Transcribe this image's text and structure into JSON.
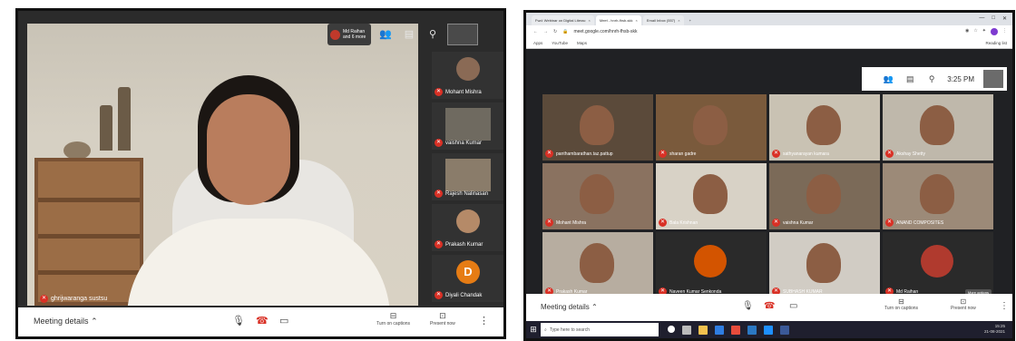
{
  "left": {
    "speaker_name": "ghrijwaranga sustsu",
    "host_chip": {
      "name": "Md Raihan",
      "sub": "and 6 more"
    },
    "participants": [
      {
        "name": "Mohant Mishra",
        "type": "photo"
      },
      {
        "name": "vaishna Kumar",
        "type": "video"
      },
      {
        "name": "Rajesh Nalinasan",
        "type": "video"
      },
      {
        "name": "Prakash Kumar",
        "type": "photo"
      },
      {
        "name": "Diyali Chandak",
        "type": "letter",
        "letter": "D"
      }
    ],
    "bottom": {
      "meeting_details": "Meeting details",
      "captions_label": "Turn on captions",
      "present_label": "Present now"
    }
  },
  "right": {
    "tabs": [
      {
        "label": "Fwd: Webinar on Digital Literac"
      },
      {
        "label": "Meet - hnrh-fhsb-skk",
        "active": true
      },
      {
        "label": "Email Inbox (557)"
      }
    ],
    "url": "meet.google.com/hnrh-fhsb-skk",
    "bookmarks": [
      "Apps",
      "YouTube",
      "Maps"
    ],
    "reading_list": "Reading list",
    "clock": "3:25 PM",
    "tiles": [
      {
        "name": "panthambarathan.taz.pattup",
        "bg": "#5b4a3a"
      },
      {
        "name": "sharan gadre",
        "bg": "#7a5a3c"
      },
      {
        "name": "sathyanarayan kumara",
        "bg": "#c9c2b3"
      },
      {
        "name": "Akshay Shetty",
        "bg": "#bfb8ab"
      },
      {
        "name": "Mohant Mishra",
        "bg": "#8a7260"
      },
      {
        "name": "Bala Krishnan",
        "bg": "#d8d2c6"
      },
      {
        "name": "vaishna Kumar",
        "bg": "#7b6a58"
      },
      {
        "name": "ANAND COMPOSITES",
        "bg": "#9c8a78"
      },
      {
        "name": "Prakash Kumar",
        "bg": "#b7ada0"
      },
      {
        "name": "Naveen Kumar Senkonda",
        "bg": "#2a2a2a",
        "avatar": true
      },
      {
        "name": "SUBHASH KUMAR",
        "bg": "#d1ccc4"
      },
      {
        "name": "Md Raihan",
        "bg": "#2a2a2a",
        "avatar": true
      }
    ],
    "more_options": "More options",
    "bottom": {
      "meeting_details": "Meeting details",
      "captions_label": "Turn on captions",
      "present_label": "Present now"
    },
    "taskbar": {
      "search": "Type here to search",
      "time": "15:25",
      "date": "21-08-2021"
    }
  }
}
